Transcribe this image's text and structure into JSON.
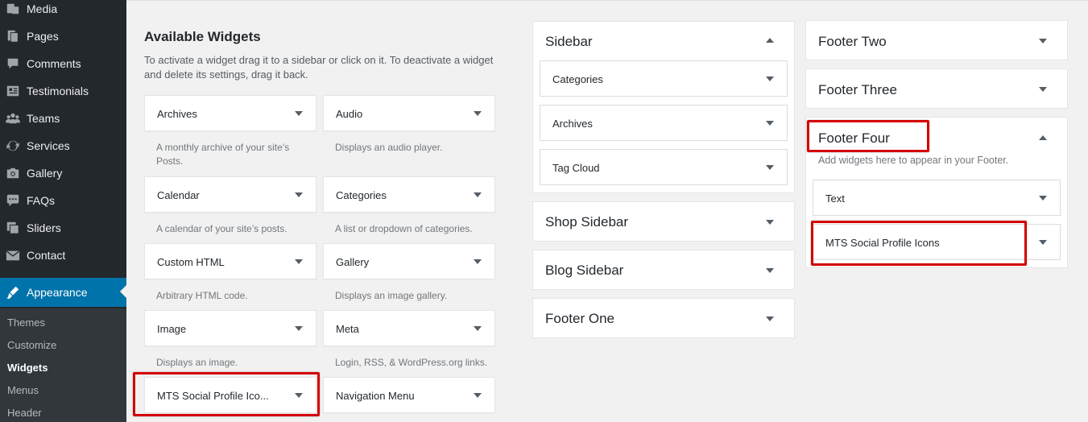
{
  "admin_menu": {
    "items": [
      {
        "label": "Media",
        "icon": "media-icon"
      },
      {
        "label": "Pages",
        "icon": "pages-icon"
      },
      {
        "label": "Comments",
        "icon": "comments-icon"
      },
      {
        "label": "Testimonials",
        "icon": "testimonials-icon"
      },
      {
        "label": "Teams",
        "icon": "teams-icon"
      },
      {
        "label": "Services",
        "icon": "services-icon"
      },
      {
        "label": "Gallery",
        "icon": "gallery-icon"
      },
      {
        "label": "FAQs",
        "icon": "faqs-icon"
      },
      {
        "label": "Sliders",
        "icon": "sliders-icon"
      },
      {
        "label": "Contact",
        "icon": "contact-icon"
      }
    ],
    "current": {
      "label": "Appearance",
      "icon": "appearance-icon"
    },
    "submenu": [
      "Themes",
      "Customize",
      "Widgets",
      "Menus",
      "Header"
    ],
    "submenu_current": "Widgets",
    "colors": {
      "bg": "#23282d",
      "current": "#0073aa",
      "highlight": "#d40000"
    }
  },
  "available_widgets": {
    "title": "Available Widgets",
    "description": "To activate a widget drag it to a sidebar or click on it. To deactivate a widget and delete its settings, drag it back.",
    "widgets": [
      {
        "title": "Archives",
        "desc": "A monthly archive of your site’s Posts."
      },
      {
        "title": "Audio",
        "desc": "Displays an audio player."
      },
      {
        "title": "Calendar",
        "desc": "A calendar of your site’s posts."
      },
      {
        "title": "Categories",
        "desc": "A list or dropdown of categories."
      },
      {
        "title": "Custom HTML",
        "desc": "Arbitrary HTML code."
      },
      {
        "title": "Gallery",
        "desc": "Displays an image gallery."
      },
      {
        "title": "Image",
        "desc": "Displays an image."
      },
      {
        "title": "Meta",
        "desc": "Login, RSS, & WordPress.org links."
      },
      {
        "title": "MTS Social Profile Ico...",
        "desc": ""
      },
      {
        "title": "Navigation Menu",
        "desc": ""
      }
    ]
  },
  "sidebars": {
    "sidebar": {
      "title": "Sidebar",
      "widgets": [
        "Categories",
        "Archives",
        "Tag Cloud"
      ]
    },
    "shop_sidebar": {
      "title": "Shop Sidebar"
    },
    "blog_sidebar": {
      "title": "Blog Sidebar"
    },
    "footer_one": {
      "title": "Footer One"
    },
    "footer_two": {
      "title": "Footer Two"
    },
    "footer_three": {
      "title": "Footer Three"
    },
    "footer_four": {
      "title": "Footer Four",
      "description": "Add widgets here to appear in your Footer.",
      "widgets": [
        "Text",
        "MTS Social Profile Icons"
      ]
    }
  }
}
